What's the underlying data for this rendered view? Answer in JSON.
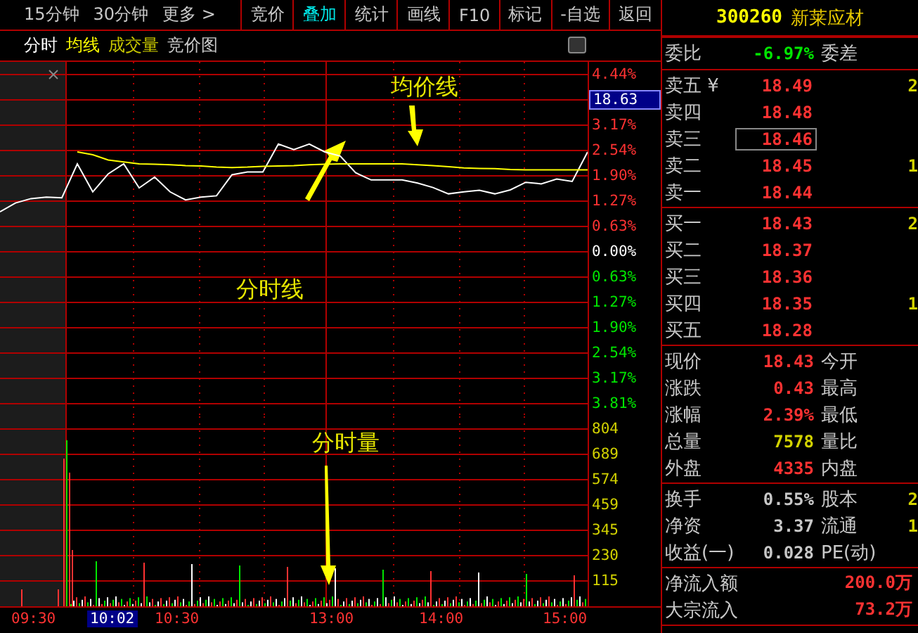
{
  "toolbar": {
    "periods": [
      {
        "label": "15分钟"
      },
      {
        "label": "30分钟"
      },
      {
        "label": "更多 >"
      }
    ],
    "buttons": [
      {
        "label": "竞价",
        "selected": false
      },
      {
        "label": "叠加",
        "selected": true
      },
      {
        "label": "统计",
        "selected": false
      },
      {
        "label": "画线",
        "selected": false
      },
      {
        "label": "F10",
        "selected": false
      },
      {
        "label": "标记",
        "selected": false
      },
      {
        "label": "-自选",
        "selected": false
      },
      {
        "label": "返回",
        "selected": false
      }
    ]
  },
  "stock": {
    "code": "300260",
    "name": "新莱应材"
  },
  "price_chart": {
    "chart_data": {
      "type": "line",
      "grid": true,
      "ylim": [
        -3.81,
        4.44
      ],
      "yticks": [
        {
          "value": 4.44,
          "label": "4.44%"
        },
        {
          "value": 3.17,
          "label": "3.17%"
        },
        {
          "value": 2.54,
          "label": "2.54%"
        },
        {
          "value": 1.9,
          "label": "1.90%"
        },
        {
          "value": 1.27,
          "label": "1.27%"
        },
        {
          "value": 0.63,
          "label": "0.63%"
        },
        {
          "value": 0,
          "label": "0.00%"
        },
        {
          "value": -0.63,
          "label": "0.63%"
        },
        {
          "value": -1.27,
          "label": "1.27%"
        },
        {
          "value": -1.9,
          "label": "1.90%"
        },
        {
          "value": -2.54,
          "label": "2.54%"
        },
        {
          "value": -3.17,
          "label": "3.17%"
        },
        {
          "value": -3.81,
          "label": "3.81%"
        }
      ],
      "series": [
        {
          "name": "分时",
          "color": "#ffffff",
          "values": [
            1.0,
            1.22,
            1.33,
            1.37,
            1.35,
            2.2,
            1.5,
            1.95,
            2.2,
            1.6,
            1.87,
            1.5,
            1.3,
            1.37,
            1.4,
            1.93,
            2.0,
            2.0,
            2.7,
            2.56,
            2.7,
            2.5,
            2.4,
            1.98,
            1.8,
            1.8,
            1.8,
            1.72,
            1.61,
            1.45,
            1.5,
            1.54,
            1.45,
            1.55,
            1.74,
            1.7,
            1.82,
            1.76,
            2.5
          ]
        },
        {
          "name": "均线",
          "color": "#ffff00",
          "values": [
            null,
            null,
            null,
            null,
            null,
            2.5,
            2.43,
            2.3,
            2.25,
            2.2,
            2.19,
            2.18,
            2.16,
            2.15,
            2.12,
            2.11,
            2.12,
            2.14,
            2.15,
            2.16,
            2.18,
            2.19,
            2.2,
            2.2,
            2.2,
            2.2,
            2.2,
            2.18,
            2.16,
            2.13,
            2.1,
            2.09,
            2.08,
            2.06,
            2.05,
            2.05,
            2.05,
            2.05,
            2.05
          ]
        }
      ]
    },
    "cursor_price": "18.63"
  },
  "chart_tabs": [
    {
      "label": "成交量",
      "color": "#c8c800"
    },
    {
      "label": "竞价图",
      "color": "#c8c8c8"
    }
  ],
  "volume_axis": [
    "804",
    "689",
    "574",
    "459",
    "345",
    "230",
    "115"
  ],
  "annotations": [
    {
      "text": "均价线"
    },
    {
      "text": "分时线"
    },
    {
      "text": "分时量"
    }
  ],
  "time_labels": [
    {
      "text": "09:30",
      "selected": false
    },
    {
      "text": "10:02",
      "selected": true
    },
    {
      "text": "10:30",
      "selected": false
    },
    {
      "text": "13:00",
      "selected": false
    },
    {
      "text": "14:00",
      "selected": false
    },
    {
      "text": "15:00",
      "selected": false
    }
  ],
  "order_ratio": {
    "label": "委比",
    "value": "-6.97%",
    "kind": "down",
    "label2": "委差"
  },
  "sell": [
    {
      "label": "卖五",
      "tag": "¥",
      "price": "18.49",
      "volume": "2",
      "selected": false
    },
    {
      "label": "卖四",
      "price": "18.48",
      "selected": false
    },
    {
      "label": "卖三",
      "price": "18.46",
      "selected": true
    },
    {
      "label": "卖二",
      "price": "18.45",
      "volume": "1",
      "selected": false
    },
    {
      "label": "卖一",
      "price": "18.44",
      "selected": false
    }
  ],
  "buy": [
    {
      "label": "买一",
      "price": "18.43",
      "volume": "2",
      "selected": false
    },
    {
      "label": "买二",
      "price": "18.37",
      "selected": false
    },
    {
      "label": "买三",
      "price": "18.36",
      "selected": false
    },
    {
      "label": "买四",
      "price": "18.35",
      "volume": "1",
      "selected": false
    },
    {
      "label": "买五",
      "price": "18.28",
      "selected": false
    }
  ],
  "quote": [
    {
      "label": "现价",
      "value": "18.43",
      "kind": "up",
      "label2": "今开"
    },
    {
      "label": "涨跌",
      "value": "0.43",
      "kind": "up",
      "label2": "最高"
    },
    {
      "label": "涨幅",
      "value": "2.39%",
      "kind": "up",
      "label2": "最低"
    },
    {
      "label": "总量",
      "value": "7578",
      "kind": "volume",
      "label2": "量比"
    },
    {
      "label": "外盘",
      "value": "4335",
      "kind": "up",
      "label2": "内盘"
    }
  ],
  "stats": [
    {
      "label": "换手",
      "value": "0.55%",
      "label2": "股本",
      "extra": "2"
    },
    {
      "label": "净资",
      "value": "3.37",
      "label2": "流通",
      "extra": "1"
    },
    {
      "label": "收益(一)",
      "value": "0.028",
      "label2": "PE(动)"
    }
  ],
  "flows": [
    {
      "label": "净流入额",
      "value": "200.0万"
    },
    {
      "label": "大宗流入",
      "value": "73.2万"
    }
  ]
}
